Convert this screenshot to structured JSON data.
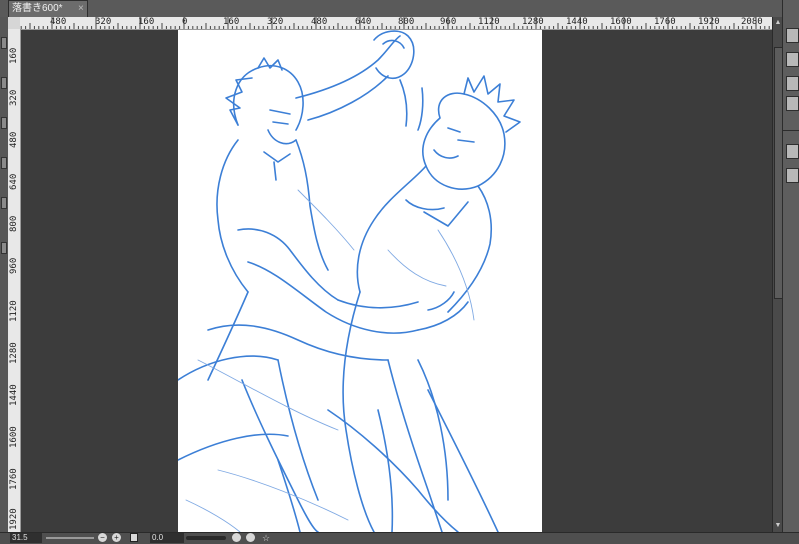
{
  "tab": {
    "title": "落書き600*",
    "close": "×"
  },
  "ruler_h": {
    "labels": [
      "480",
      "320",
      "160",
      "0",
      "160",
      "320",
      "480",
      "640",
      "800",
      "960",
      "1120",
      "1280",
      "1440",
      "1600",
      "1760",
      "1920",
      "2080"
    ]
  },
  "ruler_v": {
    "labels": [
      "160",
      "320",
      "480",
      "640",
      "800",
      "960",
      "1120",
      "1280",
      "1440",
      "1600",
      "1760",
      "1920"
    ]
  },
  "status": {
    "zoom": "31.5",
    "rotation": "0.0",
    "minus": "−",
    "plus": "+"
  },
  "colors": {
    "sketch": "#3c7fd6",
    "canvas": "#ffffff",
    "workspace": "#3c3c3c",
    "panel": "#5e5e5e"
  },
  "icons": [
    "close-icon",
    "zoom-out-icon",
    "zoom-in-icon",
    "fit-icon",
    "rotate-left-icon",
    "rotate-right-icon",
    "reset-rotation-icon",
    "folder-icon"
  ]
}
